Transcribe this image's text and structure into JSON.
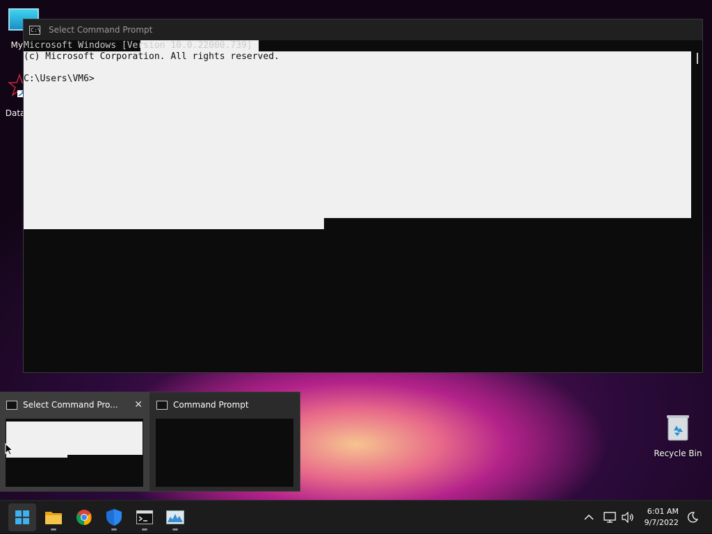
{
  "desktop": {
    "icons": [
      {
        "label": "My Co"
      },
      {
        "label": "DataW"
      },
      {
        "label": "Recycle Bin"
      }
    ]
  },
  "cmd_window": {
    "title": "Select Command Prompt",
    "lines": [
      "Microsoft Windows [Version 10.0.22000.739]",
      "(c) Microsoft Corporation. All rights reserved.",
      "",
      "C:\\Users\\VM6>"
    ]
  },
  "flyout": {
    "items": [
      {
        "title": "Select Command Pro...",
        "close": "✕"
      },
      {
        "title": "Command Prompt"
      }
    ]
  },
  "taskbar": {
    "apps": [
      {
        "icon": "windows-start-icon"
      },
      {
        "icon": "file-explorer-icon"
      },
      {
        "icon": "chrome-icon"
      },
      {
        "icon": "defender-shield-icon"
      },
      {
        "icon": "command-prompt-icon"
      },
      {
        "icon": "resource-monitor-icon"
      }
    ],
    "tray": {
      "time": "6:01 AM",
      "date": "9/7/2022"
    }
  }
}
